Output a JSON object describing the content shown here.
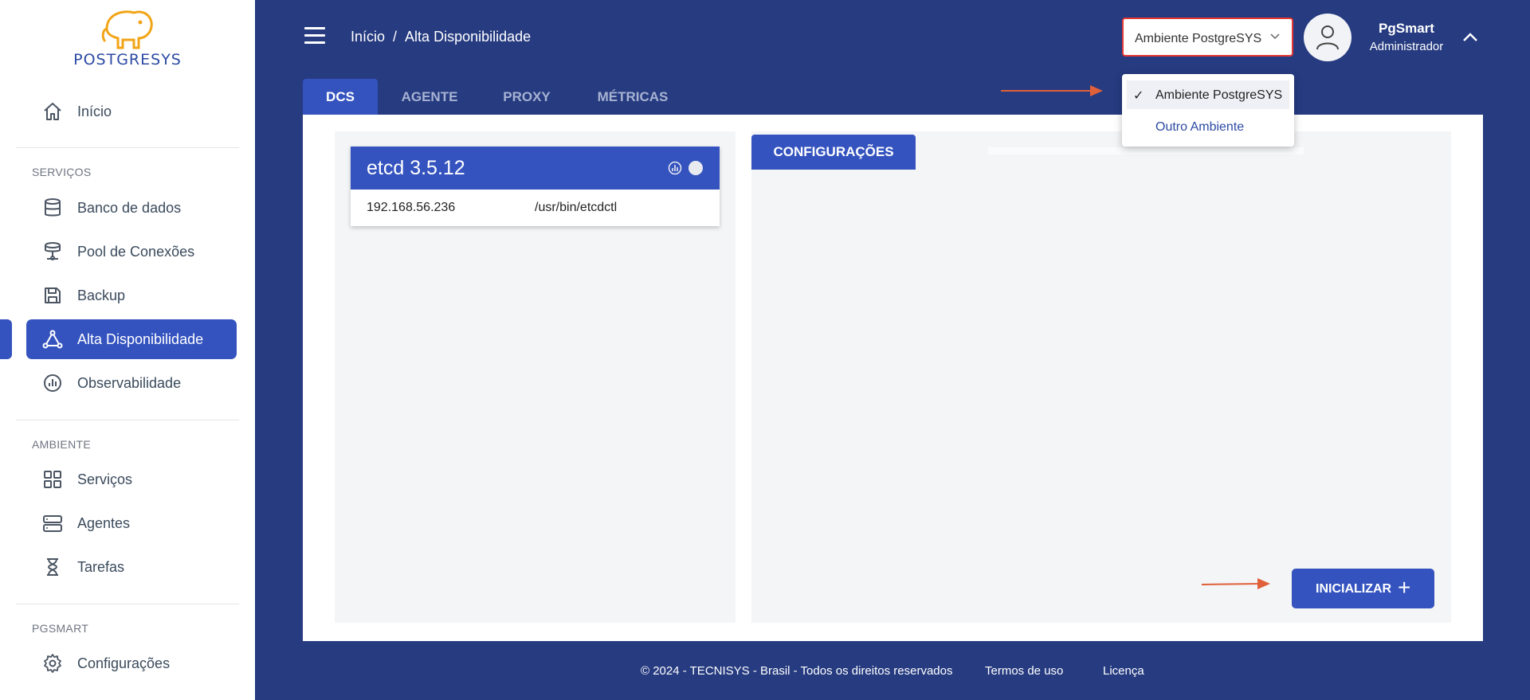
{
  "logo": {
    "text": "POSTGRESYS"
  },
  "sidebar": {
    "sections": {
      "servicos": "SERVIÇOS",
      "ambiente": "AMBIENTE",
      "pgsmart": "PGSMART"
    },
    "items": [
      {
        "label": "Início",
        "icon": "home-icon"
      },
      {
        "label": "Banco de dados",
        "icon": "database-icon"
      },
      {
        "label": "Pool de Conexões",
        "icon": "connection-pool-icon"
      },
      {
        "label": "Backup",
        "icon": "save-icon"
      },
      {
        "label": "Alta Disponibilidade",
        "icon": "triangle-nodes-icon",
        "active": true
      },
      {
        "label": "Observabilidade",
        "icon": "chart-circle-icon"
      },
      {
        "label": "Serviços",
        "icon": "grid-icon"
      },
      {
        "label": "Agentes",
        "icon": "server-icon"
      },
      {
        "label": "Tarefas",
        "icon": "hourglass-icon"
      },
      {
        "label": "Configurações",
        "icon": "gear-icon"
      }
    ]
  },
  "header": {
    "breadcrumb": [
      "Início",
      "/",
      "Alta Disponibilidade"
    ],
    "environment_select": "Ambiente PostgreSYS",
    "user": {
      "name": "PgSmart",
      "role": "Administrador"
    }
  },
  "tabs": [
    "DCS",
    "AGENTE",
    "PROXY",
    "MÉTRICAS"
  ],
  "dropdown": {
    "options": [
      {
        "label": "Ambiente PostgreSYS",
        "selected": true
      },
      {
        "label": "Outro Ambiente",
        "selected": false
      }
    ],
    "check_mark": "✓"
  },
  "dcs": {
    "node": {
      "title": "etcd 3.5.12",
      "ip": "192.168.56.236",
      "path": "/usr/bin/etcdctl"
    },
    "config_tab": "CONFIGURAÇÕES",
    "init_button": "INICIALIZAR",
    "init_icon": "+"
  },
  "footer": {
    "copyright": "© 2024 - TECNISYS - Brasil - Todos os direitos reservados",
    "terms": "Termos de uso",
    "license": "Licença"
  },
  "colors": {
    "primary": "#3453bf",
    "background": "#263b80",
    "annotation_arrow": "#e0603a",
    "select_border": "#e53935"
  }
}
